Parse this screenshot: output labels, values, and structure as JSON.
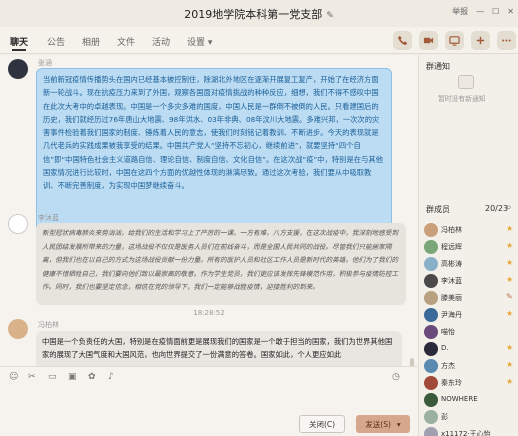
{
  "window": {
    "title": "2019地学院本科第一党支部",
    "edit_icon": "✎",
    "report_label": "举报",
    "minimize": "—",
    "maximize": "☐",
    "close": "✕"
  },
  "tabs": [
    {
      "label": "聊天"
    },
    {
      "label": "公告"
    },
    {
      "label": "相册"
    },
    {
      "label": "文件"
    },
    {
      "label": "活动"
    },
    {
      "label": "设置 ▾"
    }
  ],
  "toolbar_icons": [
    "phone-icon",
    "video-icon",
    "screen-share-icon",
    "add-app-icon",
    "more-icon"
  ],
  "messages": [
    {
      "sender": "张涵",
      "style": "blue",
      "text": "当前新冠疫情传播势头在国内已经基本被控制住，除湖北外地区在逐渐开展复工复产，开始了在经济方面新一轮战斗。现在抗疫压力来到了外国，观察各国面对疫情挑战的种种反应，细想，我们不得不感叹中国在此次大考中的卓越表现。中国是一个多灾多难的国度，中国人民是一群倒不被倒的人民。只看建国后的历史，我们就经历过76年唐山大地震、98年洪水、03年非典、08年汶川大地震。多难兴邦，一次次的灾害事件检验着我们国家的制度、锤炼着人民的意志，使我们时刻铭记着教训、不断进步。今天的表现就是几代老兵的实践成果被我享受的结果。中国共产党人“坚持不忘初心，继续前进”，就要坚持“四个自信”即“中国特色社会主义道路自信、理论自信、制度自信、文化自信”。在这次战“疫”中，特别是在与其他国家情况进行比较时，中国在这四个方面的优越性体现的淋漓尽致。通过这次考验，我们要从中吸取教训、不断完善制度，为实现中国梦继续奋斗。"
    },
    {
      "sender": "李沐蓝",
      "style": "grey",
      "text": "新型冠状病毒肺炎来势汹汹，给我们的生活和学习上了严厉的一课。一方有难，八方支援，在这次战疫中，我深刻地感受到人民团结发展所带来的力量，这场战役不仅仅是医务人员们在前线奋斗，而是全国人民共同的战役。尽管我们只能居家隔离，但我们也在以自己的方式为这场战役贡献一份力量。所有的医护人员和社区工作人员是新时代的英雄，他们为了我们的健康不惜牺牲自己，我们要向他们致以最崇高的敬意。作为学生党员，我们更应该发挥先锋模范作用，积极参与疫情防控工作。同时，我们也要坚定信念，相信在党的领导下，我们一定能够战胜疫情，迎接胜利的到来。"
    },
    {
      "sender": "冯柏林",
      "style": "plain",
      "text": "中国是一个负责任的大国，特别是在疫情面前更是展现我们的国家是一个敢于担当的国家，我们为世界其他国家的展现了大国气度和大国风范，也向世界提交了一份满意的答卷。国家如此，个人更应如此"
    }
  ],
  "timestamp": "18:28:52",
  "input_icons": [
    "emoji-icon",
    "scissors-icon",
    "folder-icon",
    "image-icon",
    "sticker-icon",
    "voice-icon",
    "history-icon"
  ],
  "buttons": {
    "close": "关闭(C)",
    "send": "发送(S)",
    "send_arrow": "▾"
  },
  "notice": {
    "title": "群通知",
    "empty_text": "暂时没有新通知"
  },
  "members": {
    "title": "群成员",
    "count": "20/23",
    "search_icon": "⌕",
    "list": [
      {
        "name": "冯柏林",
        "role": "star",
        "color": "#c9a07a"
      },
      {
        "name": "程远辉",
        "role": "star",
        "color": "#7aa67a"
      },
      {
        "name": "高彬涛",
        "role": "star",
        "color": "#8ab0c8"
      },
      {
        "name": "李沐蓝",
        "role": "star",
        "color": "#4a4a4a"
      },
      {
        "name": "滕美丽",
        "role": "pencil",
        "color": "#b8a080"
      },
      {
        "name": "尹海丹",
        "role": "star",
        "color": "#3a6a9a"
      },
      {
        "name": "喵怡",
        "role": "",
        "color": "#6a4a7a"
      },
      {
        "name": "D.",
        "role": "star",
        "color": "#2a2a3a"
      },
      {
        "name": "方杰",
        "role": "star",
        "color": "#5a8ab0"
      },
      {
        "name": "秦东玲",
        "role": "star",
        "color": "#a04a3a"
      },
      {
        "name": "NOWHERE",
        "role": "",
        "color": "#3a5a3a"
      },
      {
        "name": "彭",
        "role": "",
        "color": "#9ab0a0"
      },
      {
        "name": "x11172·王心怡",
        "role": "",
        "color": "#a0a0b0"
      }
    ]
  }
}
